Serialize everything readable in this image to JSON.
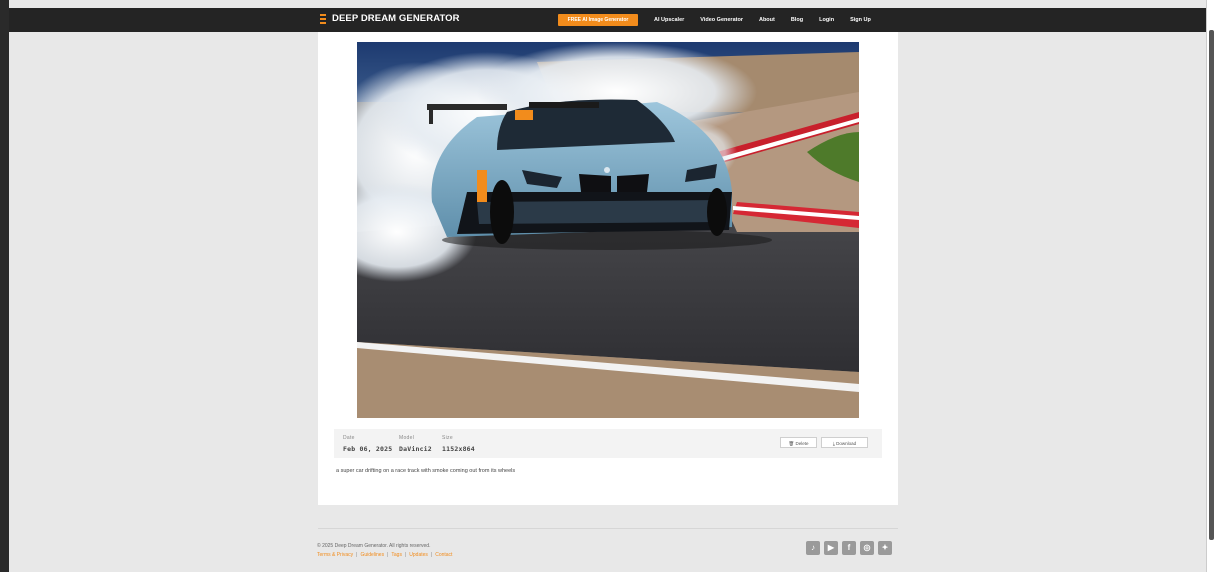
{
  "header": {
    "brand": "DEEP DREAM GENERATOR",
    "cta": "FREE AI Image Generator",
    "nav": [
      "AI Upscaler",
      "Video Generator",
      "About",
      "Blog",
      "Login",
      "Sign Up"
    ]
  },
  "image": {
    "description_icon": "race-car-drifting-image"
  },
  "meta": {
    "date_label": "Date",
    "date_value": "Feb 06, 2025",
    "model_label": "Model",
    "model_value": "DaVinci2",
    "size_label": "Size",
    "size_value": "1152x864",
    "delete_label": "Delete",
    "download_label": "Download"
  },
  "caption": "a super car drifting on a race track with smoke coming out from its wheels",
  "footer": {
    "copyright": "© 2025 Deep Dream Generator. All rights reserved.",
    "links": [
      "Terms & Privacy",
      "Guidelines",
      "Tags",
      "Updates",
      "Contact"
    ],
    "socials": [
      "tiktok-icon",
      "youtube-icon",
      "facebook-icon",
      "instagram-icon",
      "twitter-icon"
    ]
  },
  "colors": {
    "accent": "#f28c1c",
    "header_bg": "#242424",
    "page_bg": "#e8e8e8"
  }
}
